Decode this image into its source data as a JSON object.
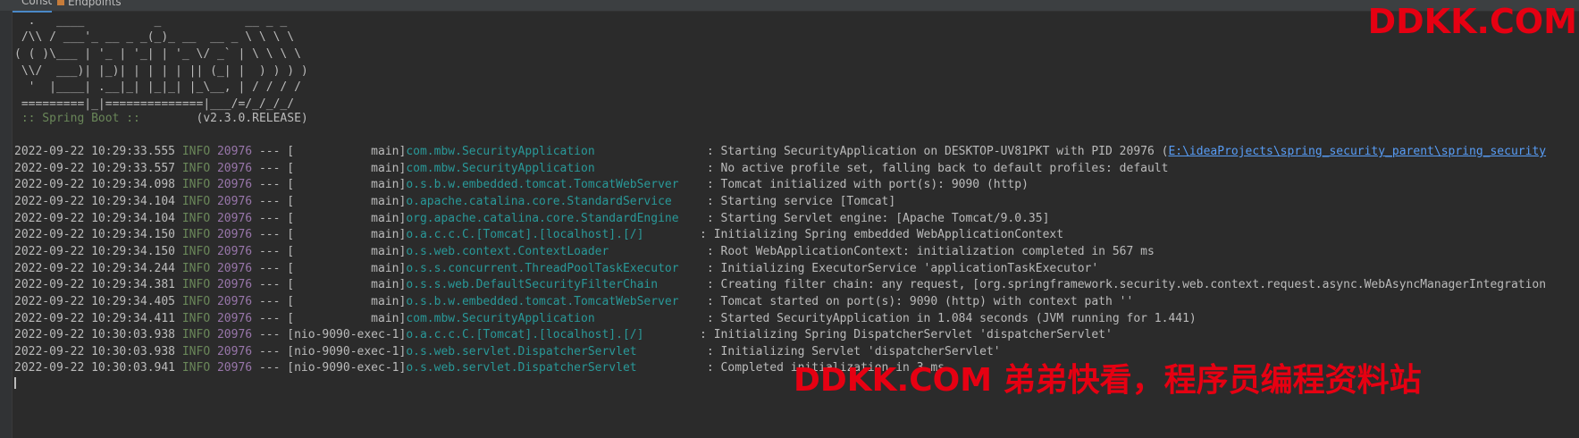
{
  "tabs": {
    "console": "Console",
    "endpoints": "Endpoints"
  },
  "banner": {
    "lines": [
      "  .   ____          _            __ _ _",
      " /\\\\ / ___'_ __ _ _(_)_ __  __ _ \\ \\ \\ \\",
      "( ( )\\___ | '_ | '_| | '_ \\/ _` | \\ \\ \\ \\",
      " \\\\/  ___)| |_)| | | | | || (_| |  ) ) ) )",
      "  '  |____| .__|_| |_|_| |_\\__, | / / / /",
      " =========|_|==============|___/=/_/_/_/"
    ],
    "spring_label": " :: Spring Boot :: ",
    "version": "       (v2.3.0.RELEASE)"
  },
  "log": [
    {
      "ts": "2022-09-22 10:29:33.555",
      "level": "INFO",
      "pid": "20976",
      "sep": " --- [",
      "thread": "           main]",
      "logger": "com.mbw.SecurityApplication               ",
      "msg": " : Starting SecurityApplication on DESKTOP-UV81PKT with PID 20976 (",
      "link": "E:\\ideaProjects\\spring_security_parent\\spring_security"
    },
    {
      "ts": "2022-09-22 10:29:33.557",
      "level": "INFO",
      "pid": "20976",
      "sep": " --- [",
      "thread": "           main]",
      "logger": "com.mbw.SecurityApplication               ",
      "msg": " : No active profile set, falling back to default profiles: default",
      "link": ""
    },
    {
      "ts": "2022-09-22 10:29:34.098",
      "level": "INFO",
      "pid": "20976",
      "sep": " --- [",
      "thread": "           main]",
      "logger": "o.s.b.w.embedded.tomcat.TomcatWebServer   ",
      "msg": " : Tomcat initialized with port(s): 9090 (http)",
      "link": ""
    },
    {
      "ts": "2022-09-22 10:29:34.104",
      "level": "INFO",
      "pid": "20976",
      "sep": " --- [",
      "thread": "           main]",
      "logger": "o.apache.catalina.core.StandardService    ",
      "msg": " : Starting service [Tomcat]",
      "link": ""
    },
    {
      "ts": "2022-09-22 10:29:34.104",
      "level": "INFO",
      "pid": "20976",
      "sep": " --- [",
      "thread": "           main]",
      "logger": "org.apache.catalina.core.StandardEngine   ",
      "msg": " : Starting Servlet engine: [Apache Tomcat/9.0.35]",
      "link": ""
    },
    {
      "ts": "2022-09-22 10:29:34.150",
      "level": "INFO",
      "pid": "20976",
      "sep": " --- [",
      "thread": "           main]",
      "logger": "o.a.c.c.C.[Tomcat].[localhost].[/]       ",
      "msg": " : Initializing Spring embedded WebApplicationContext",
      "link": ""
    },
    {
      "ts": "2022-09-22 10:29:34.150",
      "level": "INFO",
      "pid": "20976",
      "sep": " --- [",
      "thread": "           main]",
      "logger": "o.s.web.context.ContextLoader             ",
      "msg": " : Root WebApplicationContext: initialization completed in 567 ms",
      "link": ""
    },
    {
      "ts": "2022-09-22 10:29:34.244",
      "level": "INFO",
      "pid": "20976",
      "sep": " --- [",
      "thread": "           main]",
      "logger": "o.s.s.concurrent.ThreadPoolTaskExecutor   ",
      "msg": " : Initializing ExecutorService 'applicationTaskExecutor'",
      "link": ""
    },
    {
      "ts": "2022-09-22 10:29:34.381",
      "level": "INFO",
      "pid": "20976",
      "sep": " --- [",
      "thread": "           main]",
      "logger": "o.s.s.web.DefaultSecurityFilterChain      ",
      "msg": " : Creating filter chain: any request, [org.springframework.security.web.context.request.async.WebAsyncManagerIntegration",
      "link": ""
    },
    {
      "ts": "2022-09-22 10:29:34.405",
      "level": "INFO",
      "pid": "20976",
      "sep": " --- [",
      "thread": "           main]",
      "logger": "o.s.b.w.embedded.tomcat.TomcatWebServer   ",
      "msg": " : Tomcat started on port(s): 9090 (http) with context path ''",
      "link": ""
    },
    {
      "ts": "2022-09-22 10:29:34.411",
      "level": "INFO",
      "pid": "20976",
      "sep": " --- [",
      "thread": "           main]",
      "logger": "com.mbw.SecurityApplication               ",
      "msg": " : Started SecurityApplication in 1.084 seconds (JVM running for 1.441)",
      "link": ""
    },
    {
      "ts": "2022-09-22 10:30:03.938",
      "level": "INFO",
      "pid": "20976",
      "sep": " --- [",
      "thread": "nio-9090-exec-1]",
      "logger": "o.a.c.c.C.[Tomcat].[localhost].[/]       ",
      "msg": " : Initializing Spring DispatcherServlet 'dispatcherServlet'",
      "link": ""
    },
    {
      "ts": "2022-09-22 10:30:03.938",
      "level": "INFO",
      "pid": "20976",
      "sep": " --- [",
      "thread": "nio-9090-exec-1]",
      "logger": "o.s.web.servlet.DispatcherServlet         ",
      "msg": " : Initializing Servlet 'dispatcherServlet'",
      "link": ""
    },
    {
      "ts": "2022-09-22 10:30:03.941",
      "level": "INFO",
      "pid": "20976",
      "sep": " --- [",
      "thread": "nio-9090-exec-1]",
      "logger": "o.s.web.servlet.DispatcherServlet         ",
      "msg": " : Completed initialization in 3 ms",
      "link": ""
    }
  ],
  "watermarks": {
    "top": "DDKK.COM",
    "bottom": "DDKK.COM 弟弟快看，程序员编程资料站"
  },
  "colors": {
    "background": "#2b2b2b",
    "info": "#6a8759",
    "pid": "#9876aa",
    "logger": "#299999",
    "link": "#589df6",
    "watermark": "#e60012"
  }
}
